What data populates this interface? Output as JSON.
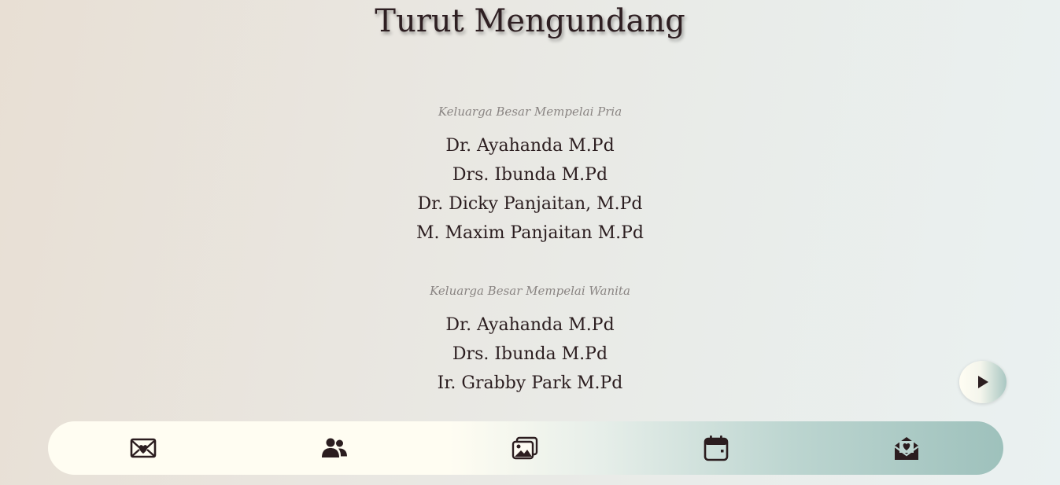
{
  "section": {
    "title": "Turut Mengundang"
  },
  "groom_family": {
    "heading": "Keluarga Besar Mempelai Pria",
    "names": [
      "Dr. Ayahanda M.Pd",
      "Drs. Ibunda M.Pd",
      "Dr. Dicky Panjaitan, M.Pd",
      "M. Maxim Panjaitan M.Pd"
    ]
  },
  "bride_family": {
    "heading": "Keluarga Besar Mempelai Wanita",
    "names": [
      "Dr. Ayahanda M.Pd",
      "Drs. Ibunda M.Pd",
      "Ir. Grabby Park M.Pd"
    ]
  },
  "music": {
    "icon": "play-icon"
  },
  "navbar": {
    "items": [
      {
        "icon": "envelope-heart-icon"
      },
      {
        "icon": "users-icon"
      },
      {
        "icon": "images-icon"
      },
      {
        "icon": "calendar-icon"
      },
      {
        "icon": "envelope-open-heart-icon"
      }
    ]
  },
  "colors": {
    "text": "#2b1d1f",
    "muted": "#8a8583",
    "accent": "#9ec1bc",
    "cream": "#fffdf2"
  }
}
